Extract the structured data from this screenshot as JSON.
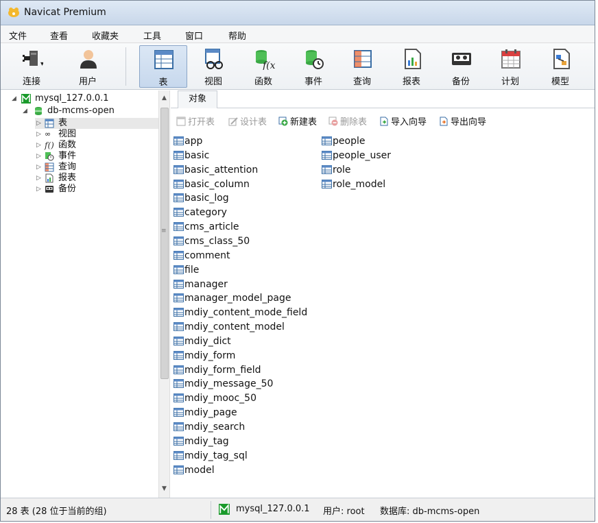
{
  "window": {
    "title": "Navicat Premium"
  },
  "menu": {
    "items": [
      "文件",
      "查看",
      "收藏夹",
      "工具",
      "窗口",
      "帮助"
    ]
  },
  "toolbar": {
    "buttons": [
      {
        "label": "连接",
        "icon": "plug-icon"
      },
      {
        "label": "用户",
        "icon": "user-icon"
      },
      {
        "label": "表",
        "icon": "table-icon",
        "active": true
      },
      {
        "label": "视图",
        "icon": "view-glasses-icon"
      },
      {
        "label": "函数",
        "icon": "function-icon"
      },
      {
        "label": "事件",
        "icon": "event-clock-icon"
      },
      {
        "label": "查询",
        "icon": "query-icon"
      },
      {
        "label": "报表",
        "icon": "report-icon"
      },
      {
        "label": "备份",
        "icon": "backup-tape-icon"
      },
      {
        "label": "计划",
        "icon": "calendar-icon"
      },
      {
        "label": "模型",
        "icon": "model-icon"
      }
    ]
  },
  "nav": {
    "connection": "mysql_127.0.0.1",
    "database": "db-mcms-open",
    "items": [
      "表",
      "视图",
      "函数",
      "事件",
      "查询",
      "报表",
      "备份"
    ]
  },
  "tabs": {
    "objects": "对象"
  },
  "object_toolbar": {
    "open_table": "打开表",
    "design_table": "设计表",
    "new_table": "新建表",
    "delete_table": "删除表",
    "import_wizard": "导入向导",
    "export_wizard": "导出向导"
  },
  "tables": {
    "col1": [
      "app",
      "basic",
      "basic_attention",
      "basic_column",
      "basic_log",
      "category",
      "cms_article",
      "cms_class_50",
      "comment",
      "file",
      "manager",
      "manager_model_page",
      "mdiy_content_mode_field",
      "mdiy_content_model",
      "mdiy_dict",
      "mdiy_form",
      "mdiy_form_field",
      "mdiy_message_50",
      "mdiy_mooc_50",
      "mdiy_page",
      "mdiy_search",
      "mdiy_tag",
      "mdiy_tag_sql",
      "model"
    ],
    "col2": [
      "people",
      "people_user",
      "role",
      "role_model"
    ]
  },
  "status": {
    "count": "28 表 (28 位于当前的组)",
    "connection": "mysql_127.0.0.1",
    "user": "用户: root",
    "database": "数据库: db-mcms-open"
  },
  "colors": {
    "connection_green": "#1a9a2b",
    "accent_blue": "#3a7bd5",
    "active_bg": "#c7d8ed"
  }
}
